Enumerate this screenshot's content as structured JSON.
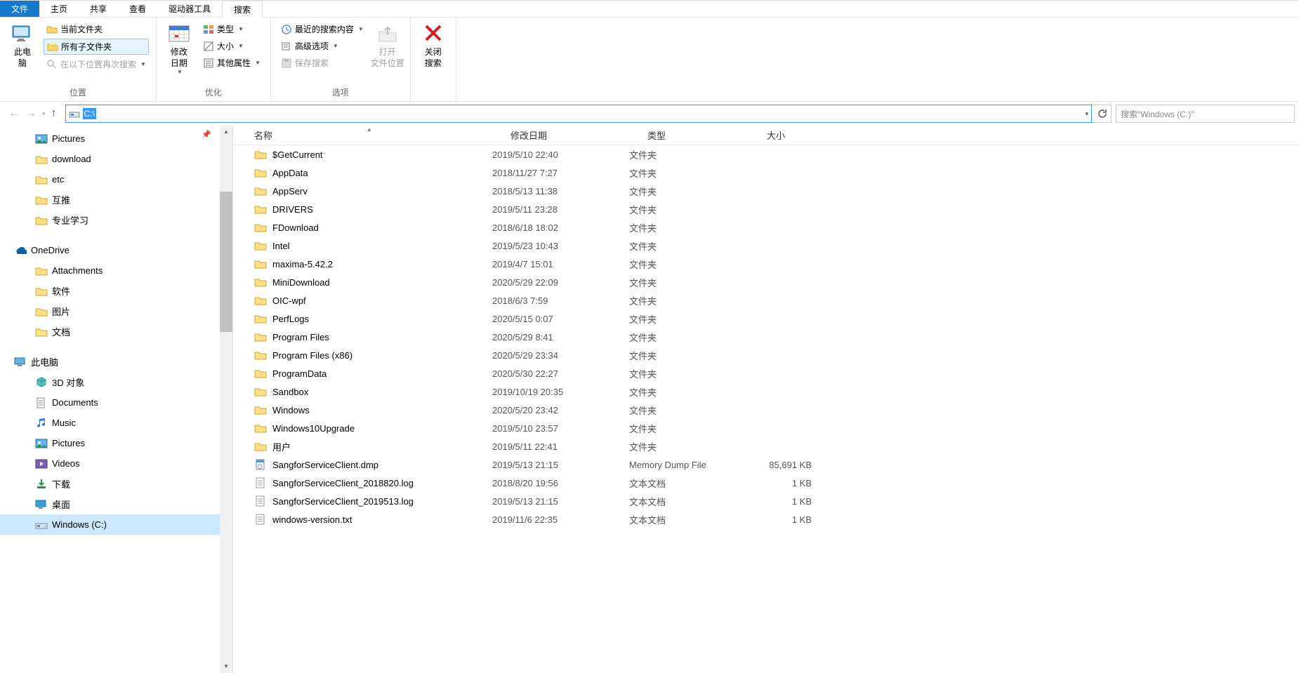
{
  "tabs": {
    "file": "文件",
    "home": "主页",
    "share": "共享",
    "view": "查看",
    "drive_tools": "驱动器工具",
    "search": "搜索"
  },
  "ribbon": {
    "group_location": "位置",
    "group_optimize": "优化",
    "group_options": "选项",
    "this_pc": "此电\n脑",
    "current_folder": "当前文件夹",
    "all_subfolders": "所有子文件夹",
    "search_again_in": "在以下位置再次搜索",
    "modify_date": "修改\n日期",
    "type": "类型",
    "size": "大小",
    "other_attrs": "其他属性",
    "recent_search": "最近的搜索内容",
    "advanced_options": "高级选项",
    "save_search": "保存搜索",
    "open_location_1": "打开",
    "open_location_2": "文件位置",
    "close_search_1": "关闭",
    "close_search_2": "搜索"
  },
  "nav": {
    "address_value": "C:\\",
    "search_placeholder": "搜索\"Windows (C:)\""
  },
  "sidebar": [
    {
      "label": "Pictures",
      "icon": "pictures",
      "level": 2,
      "pin": true
    },
    {
      "label": "download",
      "icon": "folder",
      "level": 2
    },
    {
      "label": "etc",
      "icon": "folder",
      "level": 2
    },
    {
      "label": "互推",
      "icon": "folder",
      "level": 2
    },
    {
      "label": "专业学习",
      "icon": "folder",
      "level": 2
    },
    {
      "spacer": true
    },
    {
      "label": "OneDrive",
      "icon": "onedrive",
      "level": 1
    },
    {
      "label": "Attachments",
      "icon": "folder",
      "level": 2
    },
    {
      "label": "软件",
      "icon": "folder",
      "level": 2
    },
    {
      "label": "图片",
      "icon": "folder",
      "level": 2
    },
    {
      "label": "文档",
      "icon": "folder",
      "level": 2
    },
    {
      "spacer": true
    },
    {
      "label": "此电脑",
      "icon": "thispc",
      "level": 1
    },
    {
      "label": "3D 对象",
      "icon": "3d",
      "level": 2
    },
    {
      "label": "Documents",
      "icon": "documents",
      "level": 2
    },
    {
      "label": "Music",
      "icon": "music",
      "level": 2
    },
    {
      "label": "Pictures",
      "icon": "pictures",
      "level": 2
    },
    {
      "label": "Videos",
      "icon": "videos",
      "level": 2
    },
    {
      "label": "下载",
      "icon": "downloads",
      "level": 2
    },
    {
      "label": "桌面",
      "icon": "desktop",
      "level": 2
    },
    {
      "label": "Windows (C:)",
      "icon": "drive",
      "level": 2,
      "selected": true
    }
  ],
  "columns": {
    "name": "名称",
    "date": "修改日期",
    "type": "类型",
    "size": "大小"
  },
  "files": [
    {
      "name": "$GetCurrent",
      "date": "2019/5/10 22:40",
      "type": "文件夹",
      "size": "",
      "icon": "folder"
    },
    {
      "name": "AppData",
      "date": "2018/11/27 7:27",
      "type": "文件夹",
      "size": "",
      "icon": "folder"
    },
    {
      "name": "AppServ",
      "date": "2018/5/13 11:38",
      "type": "文件夹",
      "size": "",
      "icon": "folder"
    },
    {
      "name": "DRIVERS",
      "date": "2019/5/11 23:28",
      "type": "文件夹",
      "size": "",
      "icon": "folder"
    },
    {
      "name": "FDownload",
      "date": "2018/6/18 18:02",
      "type": "文件夹",
      "size": "",
      "icon": "folder"
    },
    {
      "name": "Intel",
      "date": "2019/5/23 10:43",
      "type": "文件夹",
      "size": "",
      "icon": "folder"
    },
    {
      "name": "maxima-5.42.2",
      "date": "2019/4/7 15:01",
      "type": "文件夹",
      "size": "",
      "icon": "folder"
    },
    {
      "name": "MiniDownload",
      "date": "2020/5/29 22:09",
      "type": "文件夹",
      "size": "",
      "icon": "folder"
    },
    {
      "name": "OIC-wpf",
      "date": "2018/6/3 7:59",
      "type": "文件夹",
      "size": "",
      "icon": "folder"
    },
    {
      "name": "PerfLogs",
      "date": "2020/5/15 0:07",
      "type": "文件夹",
      "size": "",
      "icon": "folder"
    },
    {
      "name": "Program Files",
      "date": "2020/5/29 8:41",
      "type": "文件夹",
      "size": "",
      "icon": "folder"
    },
    {
      "name": "Program Files (x86)",
      "date": "2020/5/29 23:34",
      "type": "文件夹",
      "size": "",
      "icon": "folder"
    },
    {
      "name": "ProgramData",
      "date": "2020/5/30 22:27",
      "type": "文件夹",
      "size": "",
      "icon": "folder"
    },
    {
      "name": "Sandbox",
      "date": "2019/10/19 20:35",
      "type": "文件夹",
      "size": "",
      "icon": "folder"
    },
    {
      "name": "Windows",
      "date": "2020/5/20 23:42",
      "type": "文件夹",
      "size": "",
      "icon": "folder"
    },
    {
      "name": "Windows10Upgrade",
      "date": "2019/5/10 23:57",
      "type": "文件夹",
      "size": "",
      "icon": "folder"
    },
    {
      "name": "用户",
      "date": "2019/5/11 22:41",
      "type": "文件夹",
      "size": "",
      "icon": "folder"
    },
    {
      "name": "SangforServiceClient.dmp",
      "date": "2019/5/13 21:15",
      "type": "Memory Dump File",
      "size": "85,691 KB",
      "icon": "dmp"
    },
    {
      "name": "SangforServiceClient_2018820.log",
      "date": "2018/8/20 19:56",
      "type": "文本文档",
      "size": "1 KB",
      "icon": "txt"
    },
    {
      "name": "SangforServiceClient_2019513.log",
      "date": "2019/5/13 21:15",
      "type": "文本文档",
      "size": "1 KB",
      "icon": "txt"
    },
    {
      "name": "windows-version.txt",
      "date": "2019/11/6 22:35",
      "type": "文本文档",
      "size": "1 KB",
      "icon": "txt"
    }
  ]
}
